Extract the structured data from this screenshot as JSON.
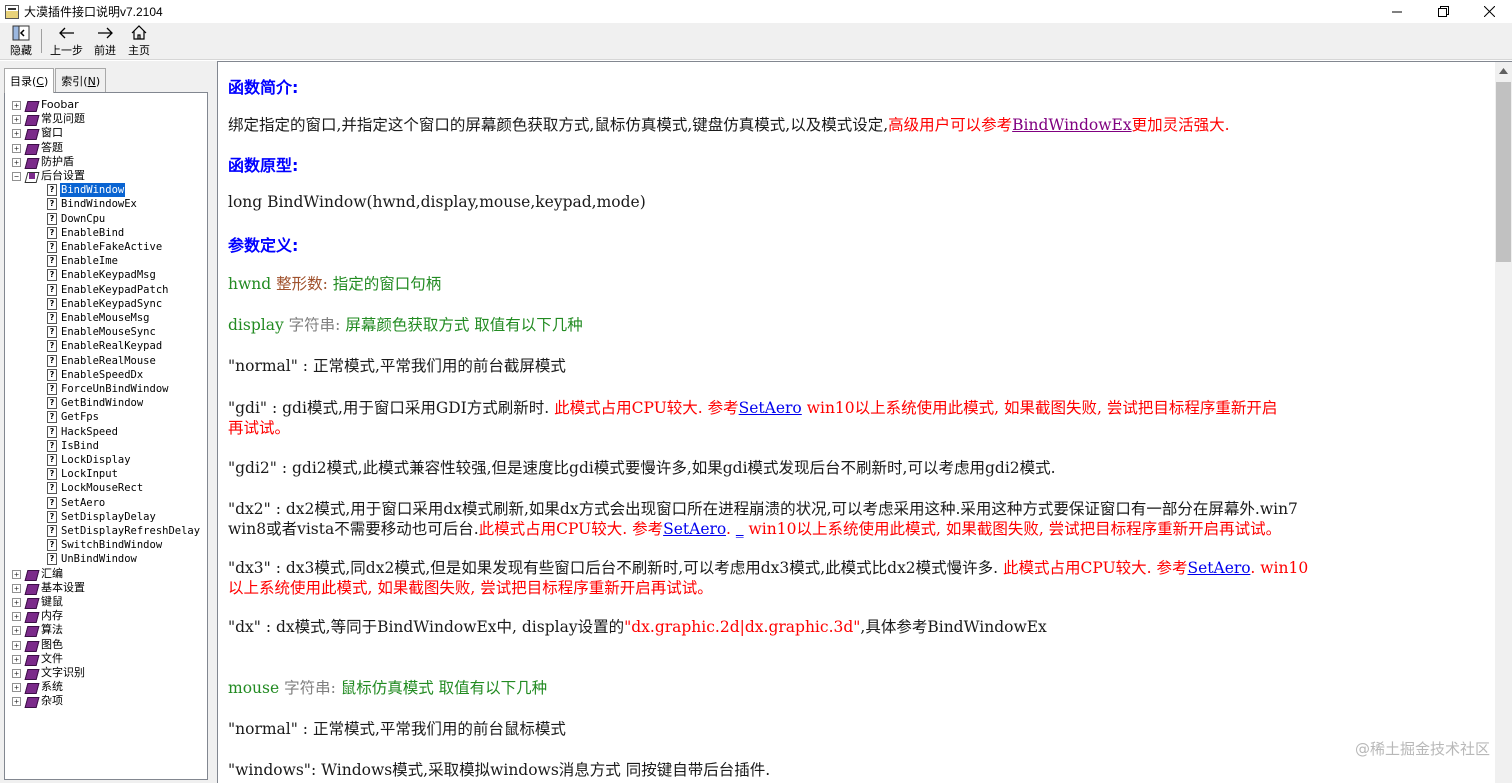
{
  "window": {
    "title": "大漠插件接口说明v7.2104",
    "controls": [
      "minimize",
      "maximize",
      "close"
    ]
  },
  "toolbar": {
    "buttons": [
      {
        "label": "隐藏",
        "icon": "hide-pane-icon"
      },
      {
        "label": "上一步",
        "icon": "back-arrow-icon"
      },
      {
        "label": "前进",
        "icon": "forward-arrow-icon"
      },
      {
        "label": "主页",
        "icon": "home-icon"
      }
    ]
  },
  "tabs": {
    "contents": "目录(C)",
    "contents_key": "C",
    "index": "索引(N)",
    "index_key": "N"
  },
  "tree": {
    "top_books": [
      "Foobar",
      "常见问题",
      "窗口",
      "答题",
      "防护盾"
    ],
    "open_book": "后台设置",
    "topics": [
      "BindWindow",
      "BindWindowEx",
      "DownCpu",
      "EnableBind",
      "EnableFakeActive",
      "EnableIme",
      "EnableKeypadMsg",
      "EnableKeypadPatch",
      "EnableKeypadSync",
      "EnableMouseMsg",
      "EnableMouseSync",
      "EnableRealKeypad",
      "EnableRealMouse",
      "EnableSpeedDx",
      "ForceUnBindWindow",
      "GetBindWindow",
      "GetFps",
      "HackSpeed",
      "IsBind",
      "LockDisplay",
      "LockInput",
      "LockMouseRect",
      "SetAero",
      "SetDisplayDelay",
      "SetDisplayRefreshDelay",
      "SwitchBindWindow",
      "UnBindWindow"
    ],
    "selected_topic": "BindWindow",
    "bottom_books": [
      "汇编",
      "基本设置",
      "键鼠",
      "内存",
      "算法",
      "图色",
      "文件",
      "文字识别",
      "系统",
      "杂项"
    ]
  },
  "doc": {
    "h_intro": "函数简介:",
    "intro_text": "绑定指定的窗口,并指定这个窗口的屏幕颜色获取方式,鼠标仿真模式,键盘仿真模式,以及模式设定,",
    "intro_red": "高级用户可以参考",
    "intro_link": "BindWindowEx",
    "intro_red2": "更加灵活强大.",
    "h_proto": "函数原型:",
    "proto": "long BindWindow(hwnd,display,mouse,keypad,mode)",
    "h_params": "参数定义:",
    "hwnd_name": "hwnd",
    "hwnd_type": "整形数:",
    "hwnd_desc": "指定的窗口句柄",
    "display_name": "display",
    "display_type": "字符串:",
    "display_desc": "屏幕颜色获取方式 取值有以下几种",
    "normal": "\"normal\" : 正常模式,平常我们用的前台截屏模式",
    "gdi_a": "\"gdi\" : gdi模式,用于窗口采用GDI方式刷新时.",
    "gdi_red": "此模式占用CPU较大.",
    "gdi_ref": "参考",
    "gdi_link": "SetAero",
    "gdi_red2": "win10以上系统使用此模式, 如果截图失败, 尝试把目标程序重新开启",
    "gdi_red3": "再试试。",
    "gdi2": "\"gdi2\" : gdi2模式,此模式兼容性较强,但是速度比gdi模式要慢许多,如果gdi模式发现后台不刷新时,可以考虑用gdi2模式.",
    "dx2_a": "\"dx2\" : dx2模式,用于窗口采用dx模式刷新,如果dx方式会出现窗口所在进程崩溃的状况,可以考虑采用这种.采用这种方式要保证窗口有一部分在屏幕外.win7",
    "dx2_b": "win8或者vista不需要移动也可后台.",
    "dx2_red": "此模式占用CPU较大.",
    "dx2_ref": "参考",
    "dx2_link": "SetAero",
    "dx2_dot": ".",
    "dx2_underscore": "_",
    "dx2_red2": "win10以上系统使用此模式, 如果截图失败, 尝试把目标程序重新开启再试试。",
    "dx3_a": "\"dx3\" : dx3模式,同dx2模式,但是如果发现有些窗口后台不刷新时,可以考虑用dx3模式,此模式比dx2模式慢许多.",
    "dx3_red": "此模式占用CPU较大.",
    "dx3_ref": "参考",
    "dx3_link": "SetAero",
    "dx3_dot": ".",
    "dx3_red2": "win10",
    "dx3_red3": "以上系统使用此模式, 如果截图失败, 尝试把目标程序重新开启再试试。",
    "dx_a": "\"dx\" : dx模式,等同于BindWindowEx中, display设置的",
    "dx_red": "\"dx.graphic.2d|dx.graphic.3d\"",
    "dx_b": ",具体参考BindWindowEx",
    "mouse_name": "mouse",
    "mouse_type": "字符串:",
    "mouse_desc": "鼠标仿真模式 取值有以下几种",
    "mnormal": "\"normal\" : 正常模式,平常我们用的前台鼠标模式",
    "mwindows": "\"windows\": Windows模式,采取模拟windows消息方式 同按键自带后台插件."
  },
  "watermark": "@稀土掘金技术社区"
}
